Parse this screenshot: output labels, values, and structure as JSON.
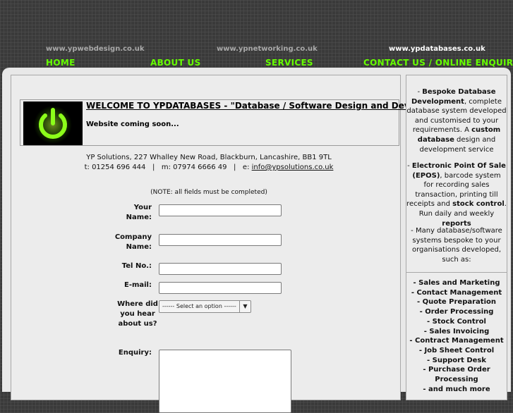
{
  "sites": [
    {
      "label": "www.ypwebdesign.co.uk"
    },
    {
      "label": "www.ypnetworking.co.uk"
    },
    {
      "label": "www.ypdatabases.co.uk"
    }
  ],
  "nav": {
    "home": "HOME",
    "about": "ABOUT US",
    "services": "SERVICES",
    "contact": "CONTACT US / ONLINE ENQUIRY"
  },
  "welcome": {
    "title": "WELCOME TO YPDATABASES - \"Database / Software Design and Development\"",
    "subtitle": "Website coming soon..."
  },
  "company": {
    "address": "YP Solutions, 227 Whalley New Road, Blackburn, Lancashire, BB1 9TL",
    "contact_prefix": "t: 01254 696 444   |   m: 07974 6666 49   |   e: ",
    "email": "info@ypsolutions.co.uk"
  },
  "form": {
    "note": "(NOTE: all fields must be completed)",
    "name_label": "Your Name:",
    "company_label": "Company Name:",
    "tel_label": "Tel No.:",
    "email_label": "E-mail:",
    "hear_label": "Where did you hear about us?",
    "hear_selected": "------ Select an option ------",
    "enquiry_label": "Enquiry:"
  },
  "sidebar": {
    "p1_pre": "- ",
    "p1_b1": "Bespoke Database Development",
    "p1_mid": ", complete database system developed and customised to your requirements. A ",
    "p1_b2": "custom database",
    "p1_post": " design and development service",
    "p2_pre": "- ",
    "p2_b1": "Electronic Point Of Sale (EPOS)",
    "p2_mid": ", barcode system for recording sales transaction, printing till receipts and ",
    "p2_b2": "stock control",
    "p2_mid2": ". Run daily and weekly ",
    "p2_b3": "reports",
    "p3": "- Many database/software systems bespoke to your organisations developed, such as:",
    "list": [
      "- Sales and Marketing",
      "- Contact Management",
      "- Quote Preparation",
      "- Order Processing",
      "- Stock Control",
      "- Sales Invoicing",
      "- Contract Management",
      "- Job Sheet Control",
      "- Support Desk",
      "- Purchase Order Processing",
      "- and much more"
    ]
  },
  "colors": {
    "nav_green": "#66ff00",
    "logo_green": "#8cff1a"
  }
}
